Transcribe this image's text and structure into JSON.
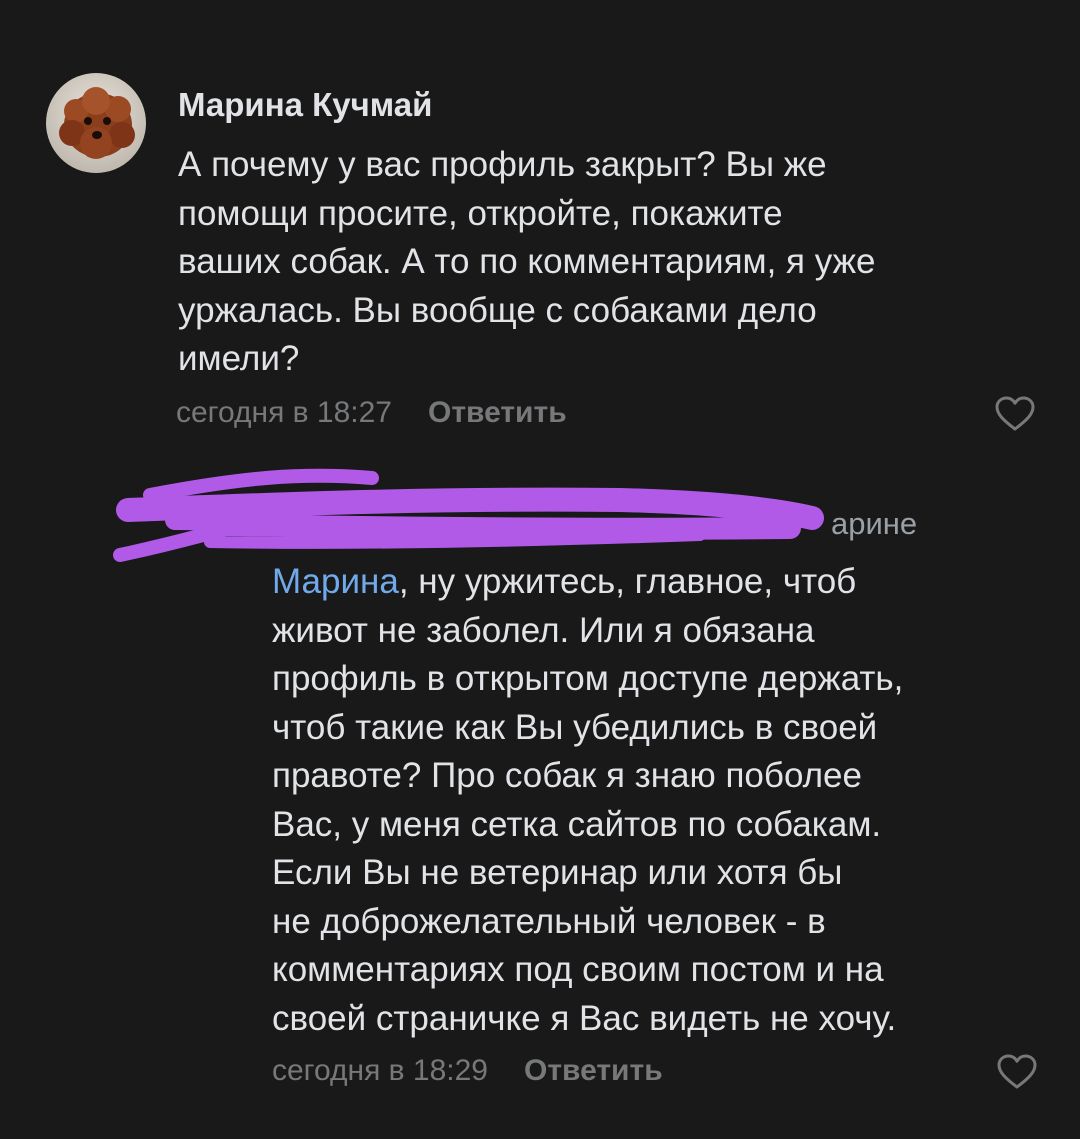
{
  "comments": [
    {
      "author": "Марина Кучмай",
      "avatar": "poodle-avatar",
      "text_lines": [
        "А почему у вас профиль закрыт? Вы же",
        "помощи просите, откройте, покажите",
        "ваших собак. А то по комментариям, я уже",
        "уржалась. Вы вообще с собаками дело",
        "имели?"
      ],
      "time": "сегодня в 18:27",
      "reply_label": "Ответить",
      "like_icon": "heart-icon"
    },
    {
      "reply_to_visible": "арине",
      "mention": "Марина",
      "first_line_rest": ", ну уржитесь, главное, чтоб",
      "text_lines": [
        "живот не заболел. Или я обязана",
        "профиль в открытом доступе держать,",
        "чтоб такие как Вы убедились в своей",
        "правоте? Про собак я знаю поболее",
        "Вас, у меня сетка сайтов по собакам.",
        "Если Вы не ветеринар или хотя бы",
        "не доброжелательный человек - в",
        "комментариях под своим постом и на",
        "своей страничке я Вас видеть не хочу."
      ],
      "time": "сегодня в 18:29",
      "reply_label": "Ответить",
      "like_icon": "heart-icon"
    }
  ],
  "colors": {
    "background": "#19191a",
    "text": "#e1e3e6",
    "meta": "#76787a",
    "mention": "#71aaeb",
    "redaction": "#b15ae8"
  }
}
